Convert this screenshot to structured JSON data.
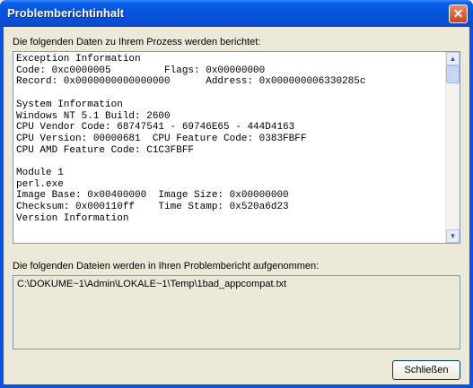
{
  "window": {
    "title": "Problemberichtinhalt",
    "close_glyph": "✕"
  },
  "process_data": {
    "label": "Die folgenden Daten zu Ihrem Prozess werden berichtet:",
    "lines": [
      "Exception Information",
      "Code: 0xc0000005         Flags: 0x00000000",
      "Record: 0x0000000000000000      Address: 0x000000006330285c",
      "",
      "System Information",
      "Windows NT 5.1 Build: 2600",
      "CPU Vendor Code: 68747541 - 69746E65 - 444D4163",
      "CPU Version: 00000681  CPU Feature Code: 0383FBFF",
      "CPU AMD Feature Code: C1C3FBFF",
      "",
      "Module 1",
      "perl.exe",
      "Image Base: 0x00400000  Image Size: 0x00000000",
      "Checksum: 0x000110ff    Time Stamp: 0x520a6d23",
      "Version Information"
    ]
  },
  "files": {
    "label": "Die folgenden Dateien werden in Ihren Problembericht aufgenommen:",
    "list": "C:\\DOKUME~1\\Admin\\LOKALE~1\\Temp\\1bad_appcompat.txt"
  },
  "buttons": {
    "close_label": "Schließen"
  },
  "colors": {
    "titlebar": "#0a53e0",
    "dialog_bg": "#ece9d8",
    "border": "#7f9db9"
  }
}
